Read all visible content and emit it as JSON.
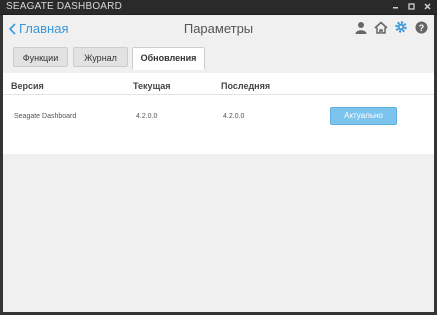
{
  "window": {
    "title": "SEAGATE DASHBOARD",
    "controls": [
      "minimize",
      "maximize",
      "close"
    ]
  },
  "header": {
    "back_label": "Главная",
    "page_title": "Параметры",
    "icons": [
      "user-icon",
      "home-icon",
      "gear-icon",
      "help-icon"
    ]
  },
  "tabs": [
    {
      "label": "Функции",
      "active": false
    },
    {
      "label": "Журнал",
      "active": false
    },
    {
      "label": "Обновления",
      "active": true
    }
  ],
  "table": {
    "headers": [
      "Версия",
      "Текущая",
      "Последняя"
    ],
    "rows": [
      {
        "name": "Seagate Dashboard",
        "current": "4.2.0.0",
        "latest": "4.2.0.0",
        "status": "Актуально"
      }
    ]
  },
  "colors": {
    "accent": "#3a97d8",
    "status_button": "#7cc4ee"
  }
}
